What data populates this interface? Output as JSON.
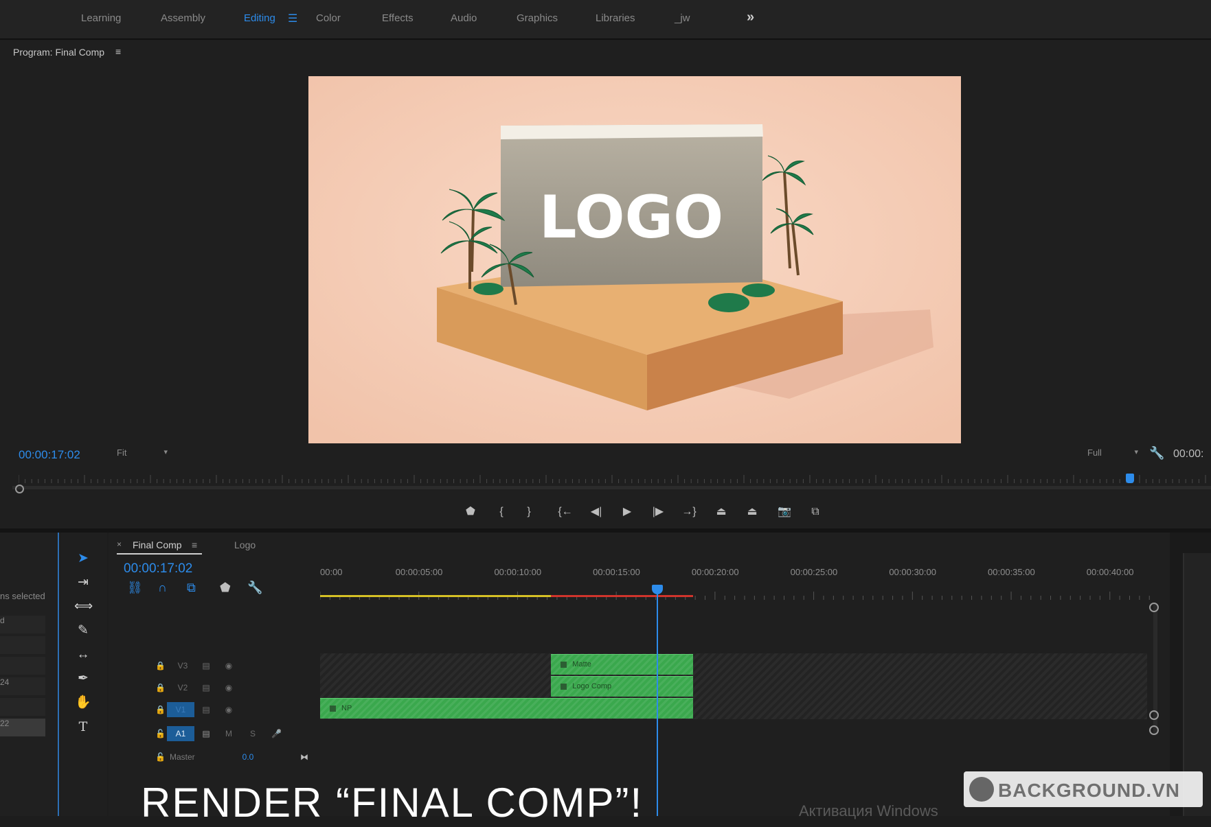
{
  "workspaces": {
    "tabs": [
      "Learning",
      "Assembly",
      "Editing",
      "Color",
      "Effects",
      "Audio",
      "Graphics",
      "Libraries",
      "_jw"
    ],
    "active": "Editing",
    "menu_icon": "hamburger-icon",
    "overflow_icon": "double-chevron-right-icon",
    "overflow_label": "»"
  },
  "program_monitor": {
    "title": "Program: Final Comp",
    "menu_label": "≡",
    "frame_text": "LOGO",
    "timecode": "00:00:17:02",
    "zoom": "Fit",
    "resolution": "Full",
    "duration_timecode": "00:00:",
    "playhead_position": 0.962,
    "frame_color": "#f6cdb6"
  },
  "transport": {
    "buttons": [
      {
        "name": "add-marker-button",
        "icon": "marker-icon",
        "label": "⬟"
      },
      {
        "name": "mark-in-button",
        "icon": "mark-in-icon",
        "label": "{"
      },
      {
        "name": "mark-out-button",
        "icon": "mark-out-icon",
        "label": "}"
      },
      {
        "name": "go-to-in-button",
        "icon": "go-to-in-icon",
        "label": "{←"
      },
      {
        "name": "step-back-button",
        "icon": "step-back-icon",
        "label": "◀|"
      },
      {
        "name": "play-button",
        "icon": "play-icon",
        "label": "▶"
      },
      {
        "name": "step-forward-button",
        "icon": "step-forward-icon",
        "label": "|▶"
      },
      {
        "name": "go-to-out-button",
        "icon": "go-to-out-icon",
        "label": "→}"
      },
      {
        "name": "lift-button",
        "icon": "lift-icon",
        "label": "⏏"
      },
      {
        "name": "extract-button",
        "icon": "extract-icon",
        "label": "⏏"
      },
      {
        "name": "export-frame-button",
        "icon": "camera-icon",
        "label": "📷"
      },
      {
        "name": "comparison-view-button",
        "icon": "comparison-icon",
        "label": "⧉"
      }
    ]
  },
  "project_panel": {
    "selection_text": "ns selected",
    "rows": [
      "d",
      "",
      "",
      "24",
      "",
      "22"
    ]
  },
  "tools": [
    {
      "name": "selection-tool",
      "icon": "arrow-icon",
      "label": "➤"
    },
    {
      "name": "track-select-tool",
      "icon": "track-select-icon",
      "label": "⇥"
    },
    {
      "name": "ripple-edit-tool",
      "icon": "ripple-edit-icon",
      "label": "⟺"
    },
    {
      "name": "razor-tool",
      "icon": "razor-icon",
      "label": "✎"
    },
    {
      "name": "slip-tool",
      "icon": "slip-icon",
      "label": "↔"
    },
    {
      "name": "pen-tool",
      "icon": "pen-icon",
      "label": "✒"
    },
    {
      "name": "hand-tool",
      "icon": "hand-icon",
      "label": "✋"
    },
    {
      "name": "type-tool",
      "icon": "type-icon",
      "label": "T"
    }
  ],
  "timeline": {
    "tabs": [
      "Final Comp",
      "Logo"
    ],
    "close_label": "×",
    "menu_label": "≡",
    "timecode": "00:00:17:02",
    "ruler_labels": [
      "00:00",
      "00:00:05:00",
      "00:00:10:00",
      "00:00:15:00",
      "00:00:20:00",
      "00:00:25:00",
      "00:00:30:00",
      "00:00:35:00",
      "00:00:40:00"
    ],
    "tracks": [
      {
        "id": "V3",
        "label": "V3",
        "selected": false
      },
      {
        "id": "V2",
        "label": "V2",
        "selected": false
      },
      {
        "id": "V1",
        "label": "V1",
        "selected": true
      },
      {
        "id": "A1",
        "label": "A1",
        "mute": "M",
        "solo": "S"
      }
    ],
    "master": {
      "label": "Master",
      "value": "0.0"
    },
    "clips": [
      {
        "track": "V3",
        "name": "Matte",
        "start": 11.7,
        "end": 18.9
      },
      {
        "track": "V2",
        "name": "Logo Comp",
        "start": 11.7,
        "end": 18.9
      },
      {
        "track": "V1",
        "name": "NP",
        "start": 0,
        "end": 18.9
      }
    ],
    "playhead_seconds": 17.07,
    "work_area": {
      "yellow_end": 11.7,
      "red_end": 18.9
    },
    "ruler_max_seconds": 42.2
  },
  "overlays": {
    "caption": "RENDER “FINAL COMP”!",
    "windows_activation": "Активация Windows",
    "watermark": "BACKGROUND.VN"
  },
  "colors": {
    "accent": "#2d8ceb",
    "clip": "#3aa84d",
    "work_yellow": "#d6c125",
    "work_red": "#d0342c"
  }
}
